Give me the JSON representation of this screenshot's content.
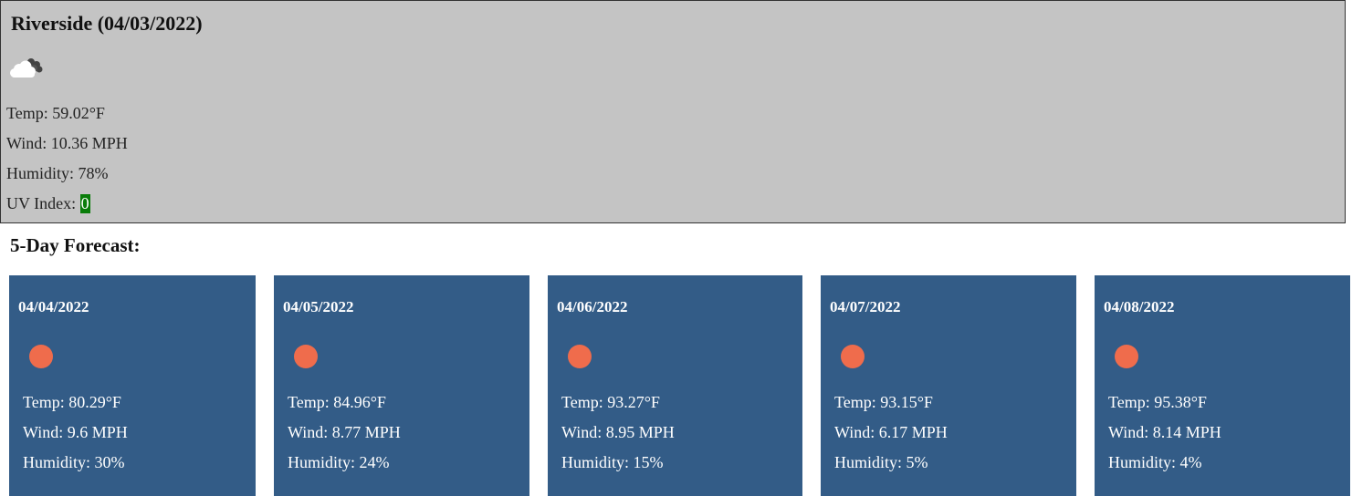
{
  "current": {
    "title": "Riverside (04/03/2022)",
    "icon": "cloudy-icon",
    "temp": "Temp: 59.02°F",
    "wind": "Wind: 10.36 MPH",
    "humidity": "Humidity: 78%",
    "uv_label": "UV Index: ",
    "uv_value": "0",
    "uv_color": "#0a7d0a"
  },
  "forecast": {
    "heading": "5-Day Forecast:",
    "card_color": "#335c87",
    "days": [
      {
        "date": "04/04/2022",
        "icon": "sun-icon",
        "temp": "Temp: 80.29°F",
        "wind": "Wind: 9.6 MPH",
        "humidity": "Humidity: 30%"
      },
      {
        "date": "04/05/2022",
        "icon": "sun-icon",
        "temp": "Temp: 84.96°F",
        "wind": "Wind: 8.77 MPH",
        "humidity": "Humidity: 24%"
      },
      {
        "date": "04/06/2022",
        "icon": "sun-icon",
        "temp": "Temp: 93.27°F",
        "wind": "Wind: 8.95 MPH",
        "humidity": "Humidity: 15%"
      },
      {
        "date": "04/07/2022",
        "icon": "sun-icon",
        "temp": "Temp: 93.15°F",
        "wind": "Wind: 6.17 MPH",
        "humidity": "Humidity: 5%"
      },
      {
        "date": "04/08/2022",
        "icon": "sun-icon",
        "temp": "Temp: 95.38°F",
        "wind": "Wind: 8.14 MPH",
        "humidity": "Humidity: 4%"
      }
    ]
  }
}
